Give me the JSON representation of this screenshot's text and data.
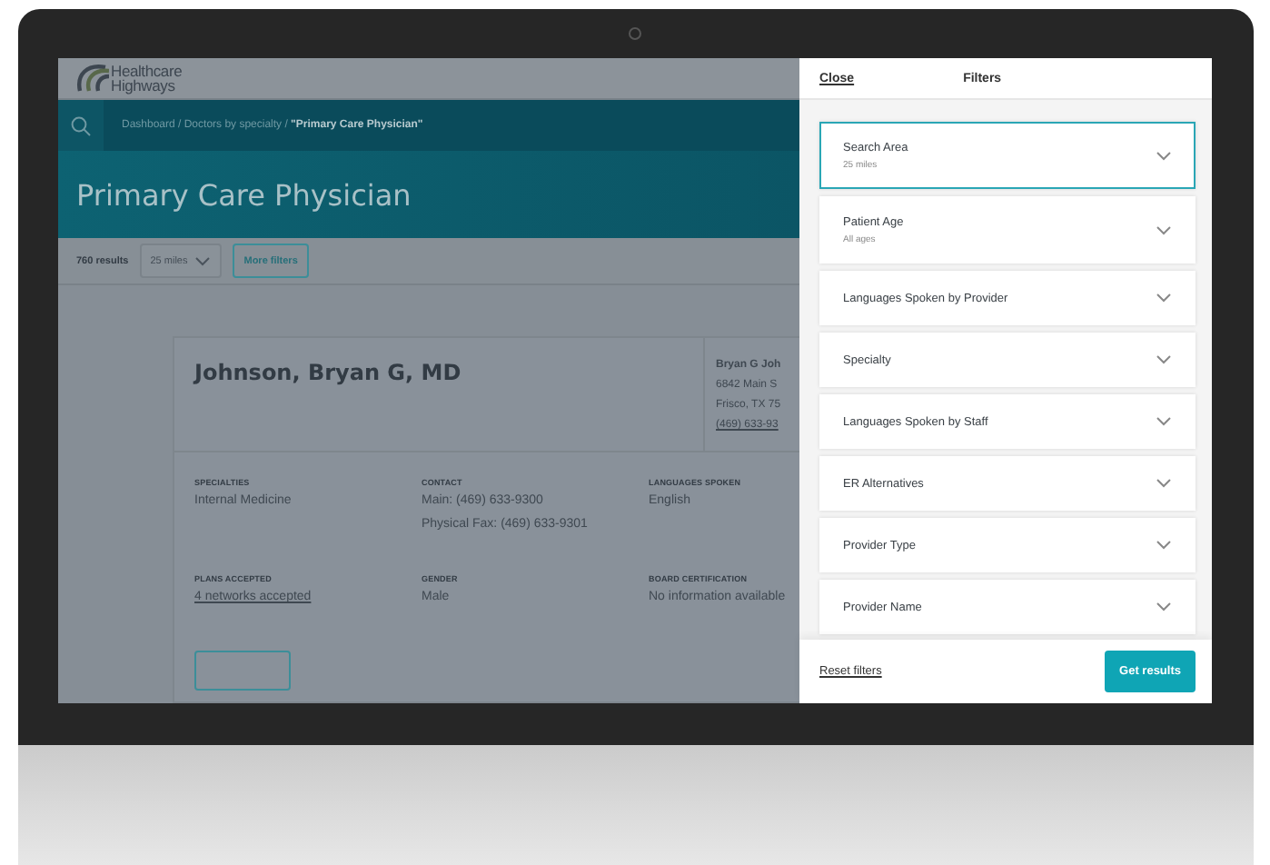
{
  "logo": {
    "line1": "Healthcare",
    "line2": "Highways"
  },
  "breadcrumb": {
    "path": "Dashboard / Doctors by specialty / ",
    "current": "\"Primary Care Physician\""
  },
  "page_title": "Primary Care Physician",
  "results_bar": {
    "count": "760 results",
    "distance": "25 miles",
    "more_filters": "More filters"
  },
  "provider": {
    "name": "Johnson, Bryan G, MD",
    "address": [
      "Bryan G Joh",
      "6842 Main S",
      "Frisco, TX 75",
      "(469) 633-93"
    ],
    "fields": [
      {
        "label": "SPECIALTIES",
        "lines": [
          "Internal Medicine"
        ],
        "kind": "text"
      },
      {
        "label": "CONTACT",
        "lines": [
          "Main: (469) 633-9300",
          "Physical Fax: (469) 633-9301"
        ],
        "kind": "text"
      },
      {
        "label": "LANGUAGES SPOKEN",
        "lines": [
          "English"
        ],
        "kind": "text"
      },
      {
        "label": "PLANS ACCEPTED",
        "lines": [
          "4 networks accepted"
        ],
        "kind": "link"
      },
      {
        "label": "GENDER",
        "lines": [
          "Male"
        ],
        "kind": "text"
      },
      {
        "label": "BOARD CERTIFICATION",
        "lines": [
          "No information available"
        ],
        "kind": "text"
      }
    ]
  },
  "drawer": {
    "close": "Close",
    "title": "Filters",
    "filters": [
      {
        "label": "Search Area",
        "value": "25 miles",
        "selected": true
      },
      {
        "label": "Patient Age",
        "value": "All ages",
        "selected": false
      },
      {
        "label": "Languages Spoken by Provider",
        "selected": false
      },
      {
        "label": "Specialty",
        "selected": false
      },
      {
        "label": "Languages Spoken by Staff",
        "selected": false
      },
      {
        "label": "ER Alternatives",
        "selected": false
      },
      {
        "label": "Provider Type",
        "selected": false
      },
      {
        "label": "Provider Name",
        "selected": false
      }
    ],
    "reset": "Reset filters",
    "submit": "Get results"
  }
}
